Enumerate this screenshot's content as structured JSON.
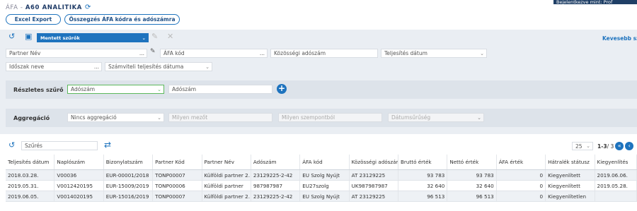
{
  "header": {
    "login_text": "Bejelentkezve mint: Prof",
    "breadcrumb_prefix": "ÁFA - ",
    "title": "A60 ANALITIKA",
    "buttons": [
      "Excel Export",
      "Összegzés ÁFA kódra és adószámra"
    ]
  },
  "toolbar": {
    "saved_filters_label": "Mentett szűrők",
    "less_label": "Kevesebb sz"
  },
  "filters": {
    "partner_name": "Partner Név",
    "vat_code": "ÁFA kód",
    "community_tax_number": "Közösségi adószám",
    "fulfillment_date": "Teljesítés dátum",
    "period_name": "Időszak neve",
    "accounting_fulfillment_date": "Számviteli teljesítés dátuma",
    "ellipsis": "..."
  },
  "detailed_filter": {
    "label": "Részletes szűrő",
    "field_select": "Adószám",
    "value_placeholder": "Adószám"
  },
  "aggregation": {
    "label": "Aggregáció",
    "select": "Nincs aggregáció",
    "placeholder_1": "Milyen mezőt",
    "placeholder_2": "Milyen szempontból",
    "placeholder_3": "Dátumsűrűség"
  },
  "grid": {
    "filter_label": "Szűrés",
    "page_size": "25",
    "page_info": "1-3",
    "page_total": " / 3",
    "columns": [
      "Teljesítés dátum",
      "Naplószám",
      "Bizonylatszám",
      "Partner Kód",
      "Partner Név",
      "Adószám",
      "ÁFA kód",
      "Közösségi adószám",
      "Bruttó érték",
      "Nettó érték",
      "ÁFA érték",
      "Hátralék státusz",
      "Kiegyenlítés"
    ],
    "rows": [
      [
        "2018.03.28.",
        "V00036",
        "EUR-00001/2018",
        "TONP00007",
        "Külföldi partner 2.",
        "23129225-2-42",
        "EU Szolg Nyújt",
        "AT 23129225",
        "93 783",
        "93 783",
        "0",
        "Kiegyenlített",
        "2019.06.06."
      ],
      [
        "2019.05.31.",
        "V0012420195",
        "EUR-15009/2019",
        "TONP00006",
        "Külföldi partner",
        "987987987",
        "EU27szolg",
        "UK987987987",
        "32 640",
        "32 640",
        "0",
        "Kiegyenlített",
        "2019.05.28."
      ],
      [
        "2019.06.05.",
        "V0014020195",
        "EUR-15016/2019",
        "TONP00007",
        "Külföldi partner 2.",
        "23129225-2-42",
        "EU Szolg Nyújt",
        "AT 23129225",
        "96 513",
        "96 513",
        "0",
        "Kiegyenlítetlen",
        ""
      ]
    ]
  }
}
